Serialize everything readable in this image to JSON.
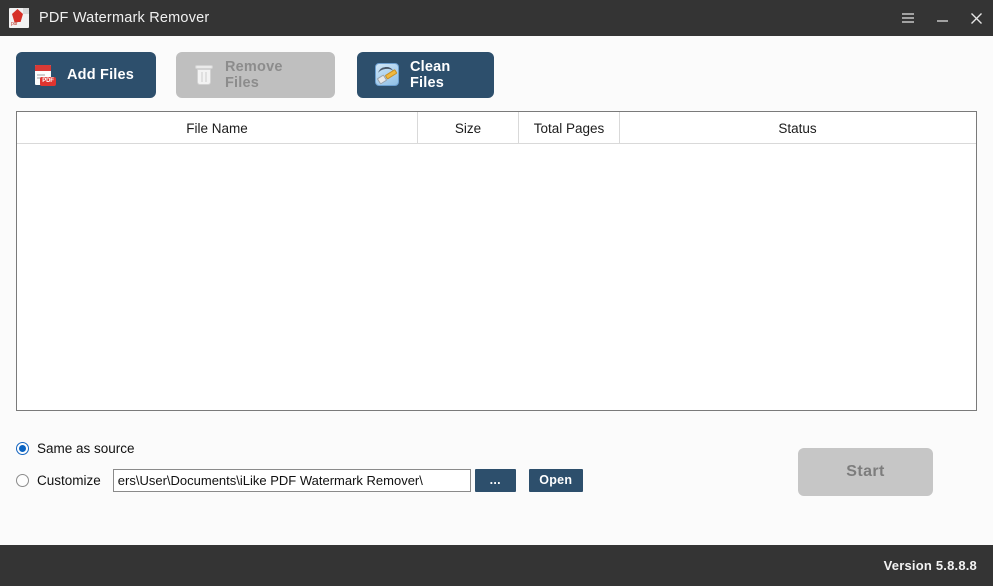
{
  "window": {
    "title": "PDF Watermark Remover",
    "app_icon": "pdf-file-icon",
    "controls": {
      "menu": "hamburger-menu-icon",
      "minimize": "minimize-icon",
      "close": "close-icon"
    },
    "titlebar_color": "#343434",
    "accent_color": "#2d4f6c"
  },
  "toolbar": {
    "add_files": {
      "label": "Add Files",
      "icon": "pdf-add-icon",
      "enabled": true
    },
    "remove_files": {
      "label": "Remove Files",
      "icon": "trash-icon",
      "enabled": false
    },
    "clean_files": {
      "label": "Clean Files",
      "icon": "clean-brush-icon",
      "enabled": true
    }
  },
  "file_table": {
    "columns": [
      "File Name",
      "Size",
      "Total Pages",
      "Status"
    ],
    "rows": []
  },
  "output": {
    "same_as_source": {
      "label": "Same as source",
      "selected": true
    },
    "customize": {
      "label": "Customize",
      "selected": false
    },
    "path_value": "ers\\User\\Documents\\iLike PDF Watermark Remover\\",
    "browse_label": "...",
    "open_label": "Open"
  },
  "actions": {
    "start": {
      "label": "Start",
      "enabled": false
    }
  },
  "statusbar": {
    "version": "Version 5.8.8.8"
  }
}
